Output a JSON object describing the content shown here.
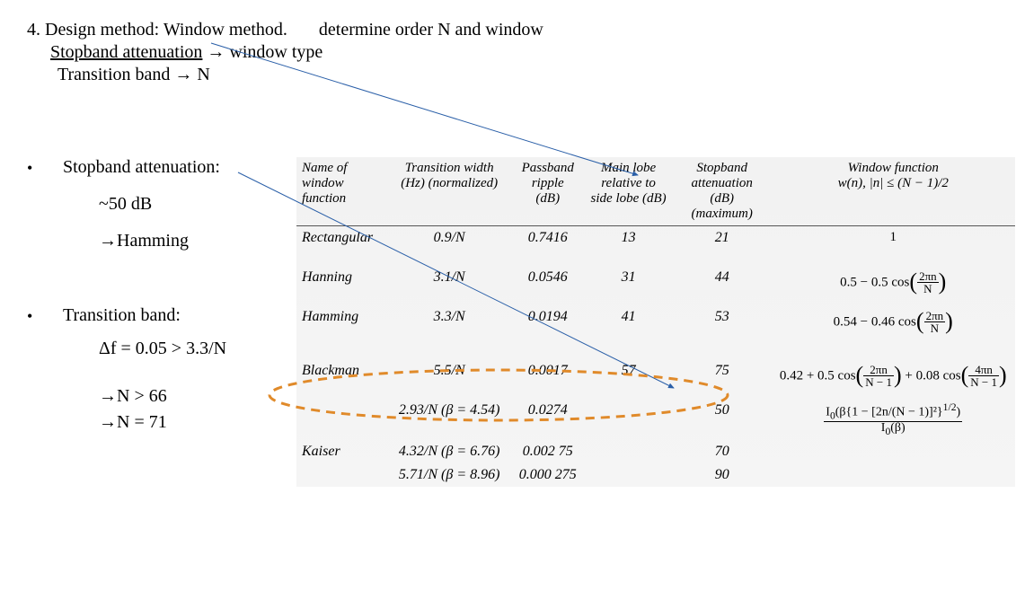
{
  "title": {
    "num": "4.",
    "main": "Design method: Window method.",
    "right": "determine order N and window",
    "line2a": "Stopband attenuation",
    "line2b": "window type",
    "line3a": "Transition band",
    "line3b": "N"
  },
  "left": {
    "b1": "Stopband attenuation:",
    "b1_sub": "~50 dB",
    "b1_res": "Hamming",
    "b2": "Transition band:",
    "b2_eq": "Δf = 0.05 > 3.3/N",
    "b2_res1": "N > 66",
    "b2_res2": "N = 71"
  },
  "th": {
    "name": "Name of window function",
    "tw": "Transition width (Hz) (normalized)",
    "pr": "Passband ripple (dB)",
    "ml": "Main lobe relative to side lobe (dB)",
    "sb": "Stopband attenuation (dB) (maximum)",
    "wf": "Window function w(n), |n| ≤ (N − 1)/2"
  },
  "rows": {
    "rect": {
      "name": "Rectangular",
      "tw": "0.9/N",
      "pr": "0.7416",
      "ml": "13",
      "sb": "21",
      "wf": "1"
    },
    "hann": {
      "name": "Hanning",
      "tw": "3.1/N",
      "pr": "0.0546",
      "ml": "31",
      "sb": "44"
    },
    "hamm": {
      "name": "Hamming",
      "tw": "3.3/N",
      "pr": "0.0194",
      "ml": "41",
      "sb": "53"
    },
    "black": {
      "name": "Blackman",
      "tw": "5.5/N",
      "pr": "0.0017",
      "ml": "57",
      "sb": "75"
    },
    "kaiser1": {
      "tw": "2.93/N (β = 4.54)",
      "pr": "0.0274",
      "ml": "",
      "sb": "50"
    },
    "kaiser2": {
      "name": "Kaiser",
      "tw": "4.32/N (β = 6.76)",
      "pr": "0.002 75",
      "ml": "",
      "sb": "70"
    },
    "kaiser3": {
      "tw": "5.71/N (β = 8.96)",
      "pr": "0.000 275",
      "ml": "",
      "sb": "90"
    }
  },
  "chart_data": {
    "type": "table",
    "title": "Window function properties",
    "columns": [
      "Name of window function",
      "Transition width (Hz)(normalized)",
      "Passband ripple (dB)",
      "Main lobe relative to side lobe (dB)",
      "Stopband attenuation (dB)(maximum)",
      "Window function w(n), |n| ≤ (N−1)/2"
    ],
    "rows": [
      [
        "Rectangular",
        "0.9/N",
        0.7416,
        13,
        21,
        "1"
      ],
      [
        "Hanning",
        "3.1/N",
        0.0546,
        31,
        44,
        "0.5 − 0.5 cos(2πn/N)"
      ],
      [
        "Hamming",
        "3.3/N",
        0.0194,
        41,
        53,
        "0.54 − 0.46 cos(2πn/N)"
      ],
      [
        "Blackman",
        "5.5/N",
        0.0017,
        57,
        75,
        "0.42 + 0.5 cos(2πn/(N−1)) + 0.08 cos(4πn/(N−1))"
      ],
      [
        "Kaiser",
        "2.93/N (β=4.54)",
        0.0274,
        null,
        50,
        "I0(β{1 − [2n/(N−1)]²}^{1/2}) / I0(β)"
      ],
      [
        "Kaiser",
        "4.32/N (β=6.76)",
        0.00275,
        null,
        70,
        "I0(β{1 − [2n/(N−1)]²}^{1/2}) / I0(β)"
      ],
      [
        "Kaiser",
        "5.71/N (β=8.96)",
        0.000275,
        null,
        90,
        "I0(β{1 − [2n/(N−1)]²}^{1/2}) / I0(β)"
      ]
    ]
  }
}
